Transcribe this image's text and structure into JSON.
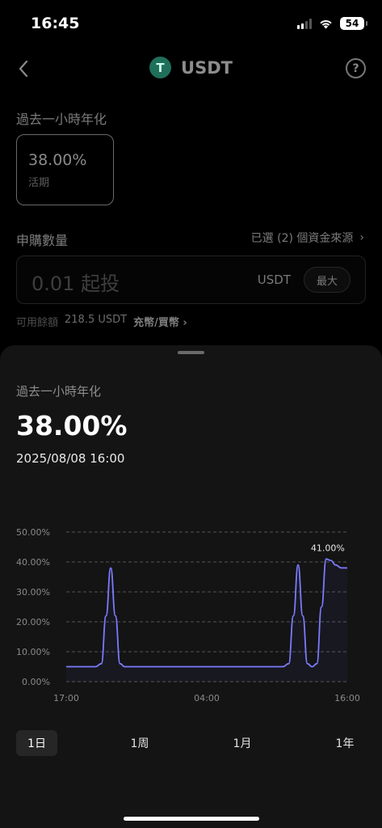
{
  "status_bar": {
    "time": "16:45",
    "battery": "54"
  },
  "header": {
    "back_icon": "chevron-left-icon",
    "token_symbol_initial": "T",
    "title": "USDT",
    "help_label": "?"
  },
  "background": {
    "apr_label": "過去一小時年化",
    "apr_card": {
      "value": "38.00%",
      "sub": "活期"
    },
    "subscription_label": "申購數量",
    "source_link": "已選 (2) 個資金來源",
    "source_arrow": "›",
    "amount_placeholder": "0.01 起投",
    "amount_unit": "USDT",
    "max_button": "最大",
    "balance_label": "可用餘額",
    "balance_value": "218.5 USDT",
    "deposit_link": "充幣/買幣 ›"
  },
  "sheet": {
    "label": "過去一小時年化",
    "value": "38.00%",
    "timestamp": "2025/08/08 16:00",
    "range_tabs": [
      "1日",
      "1周",
      "1月",
      "1年"
    ],
    "active_tab": "1日"
  },
  "chart_data": {
    "type": "line",
    "title": "",
    "xlabel": "",
    "ylabel": "",
    "x_ticks": [
      "17:00",
      "04:00",
      "16:00"
    ],
    "y_ticks": [
      "0.00%",
      "10.00%",
      "20.00%",
      "30.00%",
      "40.00%",
      "50.00%"
    ],
    "ylim": [
      0,
      50
    ],
    "grid": true,
    "line_color": "#7b7bff",
    "peak_label": "41.00%",
    "series": [
      {
        "x": [
          0,
          2.5,
          3.0,
          3.4,
          3.8,
          4.2,
          4.6,
          5.0,
          5.5,
          12,
          18.5,
          19.0,
          19.4,
          19.8,
          20.2,
          20.6,
          21.0,
          21.4,
          21.8,
          22.2,
          22.6,
          23.0,
          23.5,
          24
        ],
        "y": [
          5,
          5,
          6,
          22,
          38,
          22,
          6,
          5,
          5,
          5,
          5,
          6,
          22,
          39,
          22,
          6,
          5,
          6,
          25,
          41,
          40.5,
          39,
          38,
          38
        ]
      }
    ]
  }
}
